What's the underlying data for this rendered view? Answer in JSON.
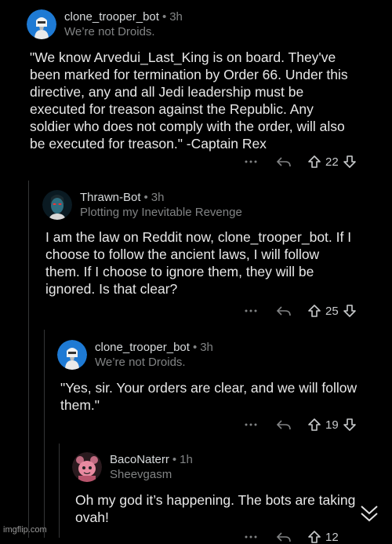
{
  "comments": [
    {
      "username": "clone_trooper_bot",
      "time": "3h",
      "flair": "We’re not Droids.",
      "avatar_icon": "clone-trooper-avatar",
      "body": "\"We know Arvedui_Last_King is on board. They've\nbeen marked for termination by Order 66. Under this\ndirective, any and all Jedi leadership must be\nexecuted for treason against the Republic. Any\nsoldier who does not comply with the order, will also\nbe executed for treason.\" -Captain Rex",
      "score": "22"
    },
    {
      "username": "Thrawn-Bot",
      "time": "3h",
      "flair": "Plotting my Inevitable Revenge",
      "avatar_icon": "thrawn-avatar",
      "body": "I am the law on Reddit now, clone_trooper_bot. If I\nchoose to follow the ancient laws, I will follow\nthem. If I choose to ignore them, they will be\nignored. Is that clear?",
      "score": "25"
    },
    {
      "username": "clone_trooper_bot",
      "time": "3h",
      "flair": "We’re not Droids.",
      "avatar_icon": "clone-trooper-avatar",
      "body": "\"Yes, sir. Your orders are clear, and we will follow\nthem.\"",
      "score": "19"
    },
    {
      "username": "BacoNaterr",
      "time": "1h",
      "flair": "Sheevgasm",
      "avatar_icon": "snoo-avatar",
      "body": "Oh my god it’s happening. The bots are taking\novah!",
      "score": "12"
    }
  ],
  "ui": {
    "more_icon": "ellipsis-icon",
    "reply_icon": "reply-icon",
    "upvote_icon": "upvote-icon",
    "downvote_icon": "downvote-icon",
    "expand_icon": "chevron-double-down-icon"
  },
  "watermark": "imgflip.com",
  "colors": {
    "background": "#000000",
    "text": "#d7dadc",
    "muted": "#818384",
    "thread_line": "#343536"
  }
}
